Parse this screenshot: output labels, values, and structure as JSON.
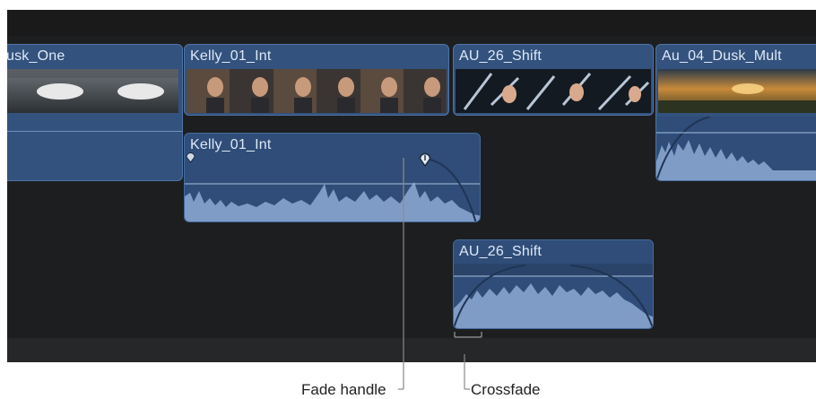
{
  "clips": {
    "video1": {
      "name": "usk_One"
    },
    "video2": {
      "name": "Kelly_01_Int"
    },
    "video3": {
      "name": "AU_26_Shift"
    },
    "video4": {
      "name": "Au_04_Dusk_Mult"
    },
    "audio1": {
      "name": "Kelly_01_Int"
    },
    "audio2": {
      "name": "AU_26_Shift"
    }
  },
  "annotations": {
    "fade_handle": "Fade handle",
    "crossfade": "Crossfade"
  },
  "colors": {
    "timeline_bg": "#1d1e20",
    "video_clip": "#33527d",
    "audio_clip": "#2f4d78",
    "waveform": "#7f9cc7"
  }
}
